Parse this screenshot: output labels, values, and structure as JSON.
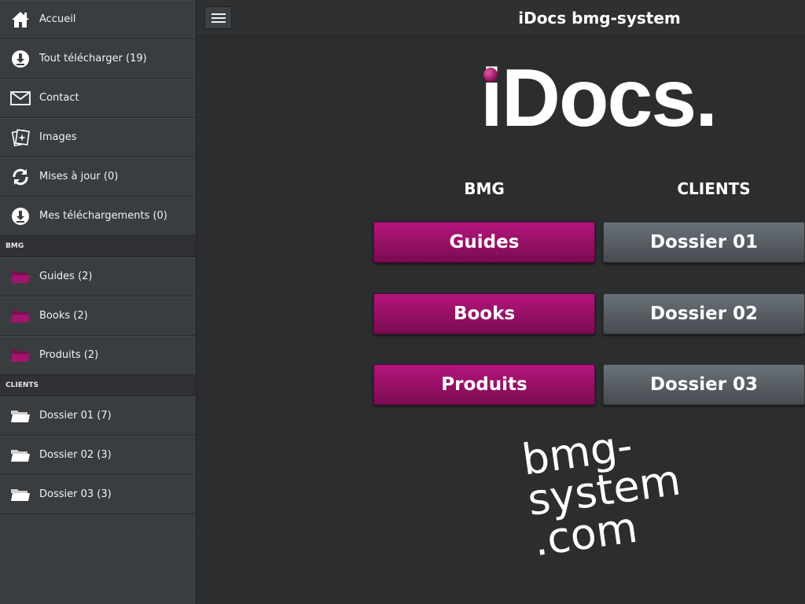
{
  "sidebar": {
    "items": [
      {
        "label": "Accueil",
        "icon": "home-icon"
      },
      {
        "label": "Tout télécharger (19)",
        "icon": "download-icon"
      },
      {
        "label": "Contact",
        "icon": "mail-icon"
      },
      {
        "label": "Images",
        "icon": "images-icon"
      },
      {
        "label": "Mises à jour (0)",
        "icon": "refresh-icon"
      },
      {
        "label": "Mes téléchargements (0)",
        "icon": "download-icon"
      }
    ],
    "sections": [
      {
        "header": "BMG",
        "items": [
          {
            "label": "Guides (2)",
            "icon": "folder-magenta-icon"
          },
          {
            "label": "Books (2)",
            "icon": "folder-magenta-icon"
          },
          {
            "label": "Produits (2)",
            "icon": "folder-magenta-icon"
          }
        ]
      },
      {
        "header": "CLIENTS",
        "items": [
          {
            "label": "Dossier 01 (7)",
            "icon": "folder-white-icon"
          },
          {
            "label": "Dossier 02 (3)",
            "icon": "folder-white-icon"
          },
          {
            "label": "Dossier 03 (3)",
            "icon": "folder-white-icon"
          }
        ]
      }
    ]
  },
  "header": {
    "title": "iDocs bmg-system",
    "menu_icon": "hamburger-icon"
  },
  "main": {
    "logo_text": "iDocs.",
    "columns": [
      {
        "heading": "BMG",
        "buttons": [
          "Guides",
          "Books",
          "Produits"
        ]
      },
      {
        "heading": "CLIENTS",
        "buttons": [
          "Dossier 01",
          "Dossier 02",
          "Dossier 03"
        ]
      }
    ],
    "domain_lines": [
      "bmg-",
      "system",
      ".com"
    ]
  },
  "colors": {
    "accent_magenta": "#9b1068",
    "button_grey": "#5a6066",
    "sidebar_bg": "#3a3d40",
    "main_bg": "#2a2c2e"
  }
}
